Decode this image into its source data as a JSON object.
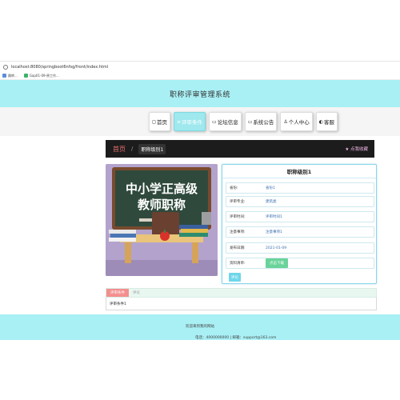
{
  "browser": {
    "url": "localhost:8080/springboot6nfsg/front/index.html",
    "bookmarks": [
      {
        "label": "跳转..."
      },
      {
        "label": "Gap01-09-原工作..."
      }
    ]
  },
  "header": {
    "title": "职称评审管理系统"
  },
  "nav": {
    "items": [
      {
        "icon": "◻",
        "label": "首页"
      },
      {
        "icon": "≡",
        "label": "评审条件"
      },
      {
        "icon": "▭",
        "label": "论坛信息"
      },
      {
        "icon": "▭",
        "label": "系统公告"
      },
      {
        "icon": "♙",
        "label": "个人中心"
      },
      {
        "icon": "◐",
        "label": "客服"
      }
    ]
  },
  "breadcrumb": {
    "home": "首页",
    "separator": "/",
    "current": "职称级别1",
    "favorite": "★ 点我收藏"
  },
  "banner": {
    "line1": "中小学正高级",
    "line2": "教师职称"
  },
  "detail": {
    "title": "职称级别1",
    "rows": [
      {
        "label": "省份:",
        "value": "省份1"
      },
      {
        "label": "评审专业:",
        "value": "建筑类"
      },
      {
        "label": "评审时间:",
        "value": "评审时间1"
      },
      {
        "label": "注意事项:",
        "value": "注意事项1"
      },
      {
        "label": "发布日期:",
        "value": "2021-01-09"
      },
      {
        "label": "资料清单:",
        "value": "点击下载"
      }
    ],
    "review_button": "评论"
  },
  "tabs": {
    "items": [
      {
        "label": "评审条件"
      },
      {
        "label": "评论"
      }
    ],
    "content": "评审条件1"
  },
  "footer": {
    "line1": "欢迎来到我的网站",
    "line2": "电话：4000000000 | 邮箱：support@163.com"
  },
  "colors": {
    "header_bg": "#a9f0f5",
    "active_tab": "#f48f8f",
    "download_btn": "#6ad39a"
  }
}
